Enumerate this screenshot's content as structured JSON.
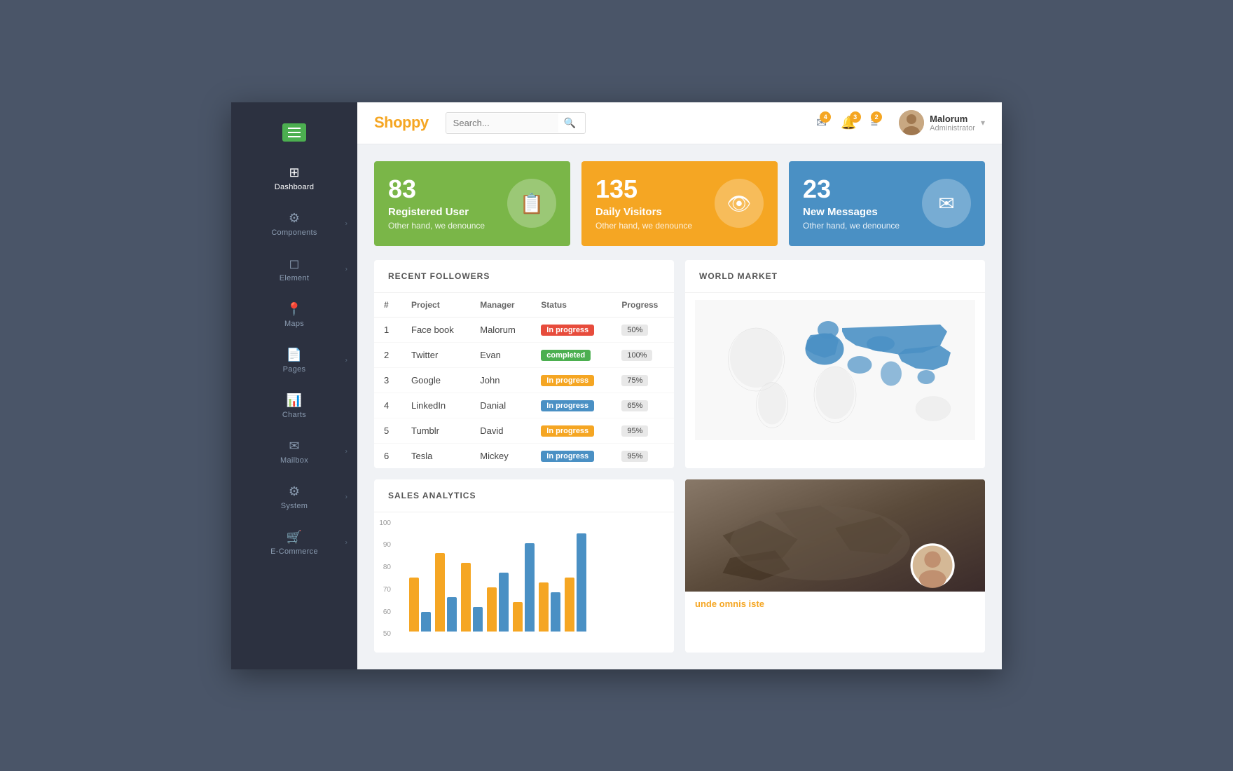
{
  "app": {
    "name": "Shoppy"
  },
  "header": {
    "search_placeholder": "Search...",
    "badges": {
      "messages": "4",
      "notifications": "3",
      "tasks": "2"
    },
    "user": {
      "name": "Malorum",
      "role": "Administrator"
    }
  },
  "sidebar": {
    "items": [
      {
        "id": "dashboard",
        "label": "Dashboard",
        "icon": "⊞",
        "has_arrow": false
      },
      {
        "id": "components",
        "label": "Components",
        "icon": "⚙",
        "has_arrow": true
      },
      {
        "id": "element",
        "label": "Element",
        "icon": "◻",
        "has_arrow": true
      },
      {
        "id": "maps",
        "label": "Maps",
        "icon": "📍",
        "has_arrow": false
      },
      {
        "id": "pages",
        "label": "Pages",
        "icon": "📄",
        "has_arrow": true
      },
      {
        "id": "charts",
        "label": "Charts",
        "icon": "📊",
        "has_arrow": false
      },
      {
        "id": "mailbox",
        "label": "Mailbox",
        "icon": "✉",
        "has_arrow": true
      },
      {
        "id": "system",
        "label": "System",
        "icon": "⚙",
        "has_arrow": true
      },
      {
        "id": "ecommerce",
        "label": "E-Commerce",
        "icon": "🛒",
        "has_arrow": true
      }
    ]
  },
  "stat_cards": [
    {
      "id": "registered",
      "number": "83",
      "label": "Registered User",
      "desc": "Other hand, we denounce",
      "icon": "📋",
      "color": "green"
    },
    {
      "id": "visitors",
      "number": "135",
      "label": "Daily Visitors",
      "desc": "Other hand, we denounce",
      "icon": "👁",
      "color": "orange"
    },
    {
      "id": "messages",
      "number": "23",
      "label": "New Messages",
      "desc": "Other hand, we denounce",
      "icon": "✉",
      "color": "blue"
    }
  ],
  "recent_followers": {
    "title": "RECENT FOLLOWERS",
    "columns": [
      "#",
      "Project",
      "Manager",
      "Status",
      "Progress"
    ],
    "rows": [
      {
        "num": "1",
        "project": "Face book",
        "manager": "Malorum",
        "status": "In progress",
        "status_class": "inprogress",
        "progress": "50%"
      },
      {
        "num": "2",
        "project": "Twitter",
        "manager": "Evan",
        "status": "completed",
        "status_class": "completed",
        "progress": "100%"
      },
      {
        "num": "3",
        "project": "Google",
        "manager": "John",
        "status": "In progress",
        "status_class": "inprogress-orange",
        "progress": "75%"
      },
      {
        "num": "4",
        "project": "LinkedIn",
        "manager": "Danial",
        "status": "In progress",
        "status_class": "inprogress-blue",
        "progress": "65%"
      },
      {
        "num": "5",
        "project": "Tumblr",
        "manager": "David",
        "status": "In progress",
        "status_class": "inprogress-orange",
        "progress": "95%"
      },
      {
        "num": "6",
        "project": "Tesla",
        "manager": "Mickey",
        "status": "In progress",
        "status_class": "inprogress-blue",
        "progress": "95%"
      }
    ]
  },
  "world_market": {
    "title": "WORLD MARKET"
  },
  "sales_analytics": {
    "title": "SALES ANALYTICS",
    "y_labels": [
      "100",
      "90",
      "80",
      "70",
      "60",
      "50"
    ],
    "bars": [
      {
        "orange": 55,
        "blue": 20
      },
      {
        "orange": 80,
        "blue": 35
      },
      {
        "orange": 70,
        "blue": 25
      },
      {
        "orange": 45,
        "blue": 60
      },
      {
        "orange": 30,
        "blue": 90
      },
      {
        "orange": 50,
        "blue": 40
      },
      {
        "orange": 55,
        "blue": 100
      }
    ]
  },
  "news": {
    "title": "unde omnis iste"
  }
}
